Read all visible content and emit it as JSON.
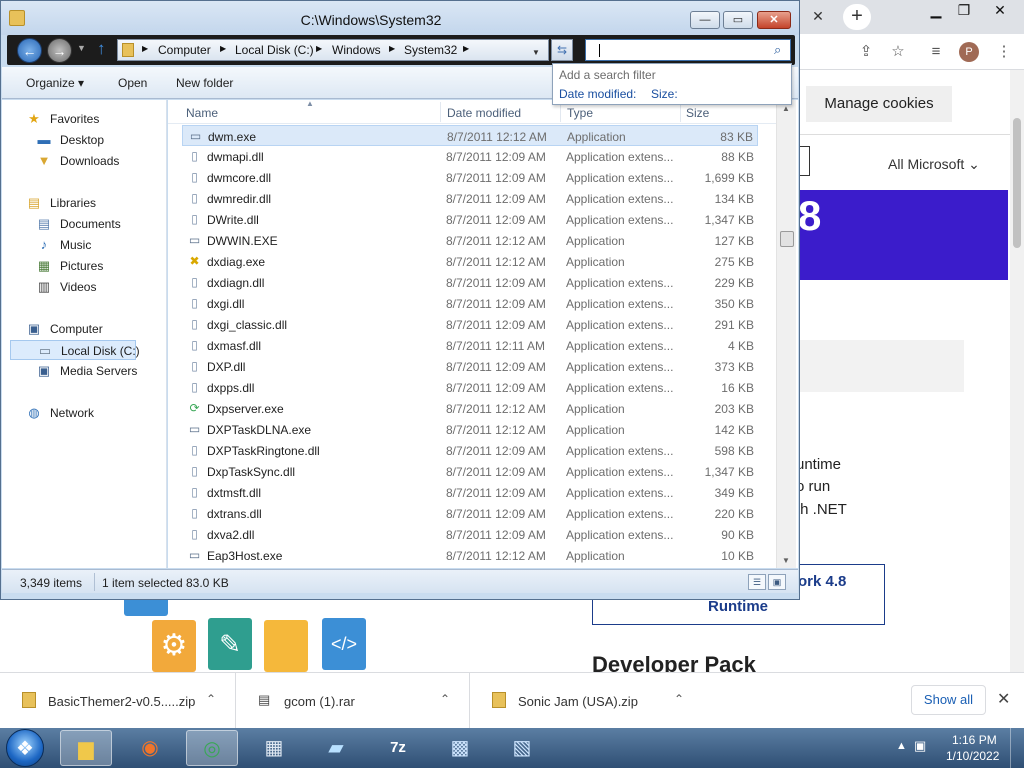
{
  "browser": {
    "manage_cookies": "Manage cookies",
    "dropdown_label": "All Microsoft",
    "hero_number": "8",
    "text_lines": [
      "untime",
      "o run",
      "th .NET"
    ],
    "runtime_link_line1": "ork 4.8",
    "runtime_link_line2": "Runtime",
    "developer_pack": "Developer Pack",
    "profile_initial": "P"
  },
  "explorer": {
    "title": "C:\\Windows\\System32",
    "breadcrumbs": [
      "Computer",
      "Local Disk (C:)",
      "Windows",
      "System32"
    ],
    "search": {
      "value": "",
      "placeholder": ""
    },
    "search_dropdown": {
      "hint": "Add a search filter",
      "options": [
        "Date modified:",
        "Size:"
      ]
    },
    "commands": {
      "organize": "Organize ▾",
      "open": "Open",
      "new_folder": "New folder"
    },
    "nav": [
      {
        "label": "Favorites",
        "icon": "★",
        "color": "#e2a614"
      },
      {
        "label": "Desktop",
        "icon": "▬",
        "color": "#2f6fb6"
      },
      {
        "label": "Downloads",
        "icon": "▼",
        "color": "#d9a732"
      },
      {
        "label": "Libraries",
        "icon": "▤",
        "color": "#d9a732"
      },
      {
        "label": "Documents",
        "icon": "▤",
        "color": "#5a7fae"
      },
      {
        "label": "Music",
        "icon": "♪",
        "color": "#2f6fb6"
      },
      {
        "label": "Pictures",
        "icon": "▦",
        "color": "#4b7c3a"
      },
      {
        "label": "Videos",
        "icon": "▥",
        "color": "#444"
      },
      {
        "label": "Computer",
        "icon": "▣",
        "color": "#3a5f8f"
      },
      {
        "label": "Local Disk (C:)",
        "icon": "▭",
        "color": "#6b7b8c"
      },
      {
        "label": "Media Servers",
        "icon": "▣",
        "color": "#3a5f8f"
      },
      {
        "label": "Network",
        "icon": "◍",
        "color": "#2f6fb6"
      }
    ],
    "columns": {
      "name": "Name",
      "date": "Date modified",
      "type": "Type",
      "size": "Size"
    },
    "files": [
      {
        "name": "dwm.exe",
        "date": "8/7/2011 12:12 AM",
        "type": "Application",
        "size": "83 KB",
        "icon": "exe"
      },
      {
        "name": "dwmapi.dll",
        "date": "8/7/2011 12:09 AM",
        "type": "Application extens...",
        "size": "88 KB",
        "icon": "dll"
      },
      {
        "name": "dwmcore.dll",
        "date": "8/7/2011 12:09 AM",
        "type": "Application extens...",
        "size": "1,699 KB",
        "icon": "dll"
      },
      {
        "name": "dwmredir.dll",
        "date": "8/7/2011 12:09 AM",
        "type": "Application extens...",
        "size": "134 KB",
        "icon": "dll"
      },
      {
        "name": "DWrite.dll",
        "date": "8/7/2011 12:09 AM",
        "type": "Application extens...",
        "size": "1,347 KB",
        "icon": "dll"
      },
      {
        "name": "DWWIN.EXE",
        "date": "8/7/2011 12:12 AM",
        "type": "Application",
        "size": "127 KB",
        "icon": "exe"
      },
      {
        "name": "dxdiag.exe",
        "date": "8/7/2011 12:12 AM",
        "type": "Application",
        "size": "275 KB",
        "icon": "dxdiag"
      },
      {
        "name": "dxdiagn.dll",
        "date": "8/7/2011 12:09 AM",
        "type": "Application extens...",
        "size": "229 KB",
        "icon": "dll"
      },
      {
        "name": "dxgi.dll",
        "date": "8/7/2011 12:09 AM",
        "type": "Application extens...",
        "size": "350 KB",
        "icon": "dll"
      },
      {
        "name": "dxgi_classic.dll",
        "date": "8/7/2011 12:09 AM",
        "type": "Application extens...",
        "size": "291 KB",
        "icon": "dll"
      },
      {
        "name": "dxmasf.dll",
        "date": "8/7/2011 12:11 AM",
        "type": "Application extens...",
        "size": "4 KB",
        "icon": "dll"
      },
      {
        "name": "DXP.dll",
        "date": "8/7/2011 12:09 AM",
        "type": "Application extens...",
        "size": "373 KB",
        "icon": "dll"
      },
      {
        "name": "dxpps.dll",
        "date": "8/7/2011 12:09 AM",
        "type": "Application extens...",
        "size": "16 KB",
        "icon": "dll"
      },
      {
        "name": "Dxpserver.exe",
        "date": "8/7/2011 12:12 AM",
        "type": "Application",
        "size": "203 KB",
        "icon": "sync"
      },
      {
        "name": "DXPTaskDLNA.exe",
        "date": "8/7/2011 12:12 AM",
        "type": "Application",
        "size": "142 KB",
        "icon": "exe"
      },
      {
        "name": "DXPTaskRingtone.dll",
        "date": "8/7/2011 12:09 AM",
        "type": "Application extens...",
        "size": "598 KB",
        "icon": "dll"
      },
      {
        "name": "DxpTaskSync.dll",
        "date": "8/7/2011 12:09 AM",
        "type": "Application extens...",
        "size": "1,347 KB",
        "icon": "dll"
      },
      {
        "name": "dxtmsft.dll",
        "date": "8/7/2011 12:09 AM",
        "type": "Application extens...",
        "size": "349 KB",
        "icon": "dll"
      },
      {
        "name": "dxtrans.dll",
        "date": "8/7/2011 12:09 AM",
        "type": "Application extens...",
        "size": "220 KB",
        "icon": "dll"
      },
      {
        "name": "dxva2.dll",
        "date": "8/7/2011 12:09 AM",
        "type": "Application extens...",
        "size": "90 KB",
        "icon": "dll"
      },
      {
        "name": "Eap3Host.exe",
        "date": "8/7/2011 12:12 AM",
        "type": "Application",
        "size": "10 KB",
        "icon": "exe"
      }
    ],
    "status": {
      "items": "3,349 items",
      "selected": "1 item selected",
      "selected_size": "83.0 KB"
    }
  },
  "downloads": {
    "items": [
      "BasicThemer2-v0.5.....zip",
      "gcom (1).rar",
      "Sonic Jam (USA).zip"
    ],
    "show_all": "Show all"
  },
  "taskbar": {
    "time": "1:16 PM",
    "date": "1/10/2022"
  }
}
